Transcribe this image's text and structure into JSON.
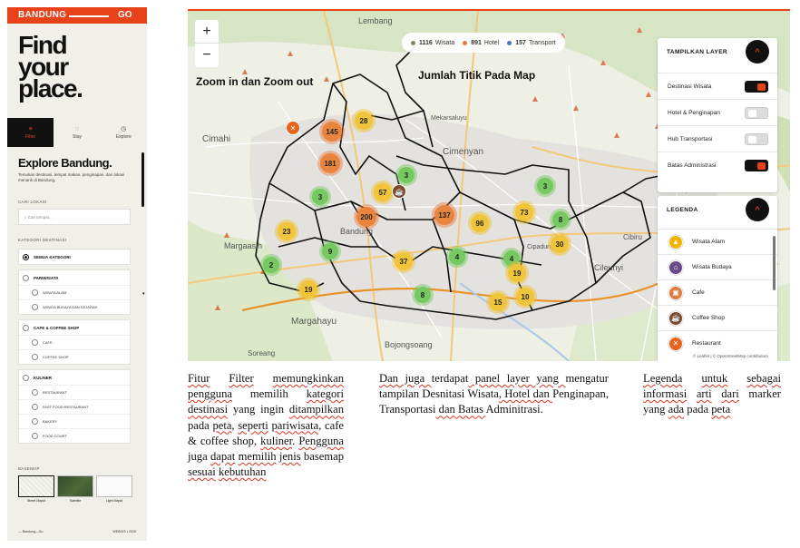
{
  "sidebar": {
    "brand": "BANDUNG",
    "brand_suffix": "GO",
    "hero": "Find\nyour\nplace.",
    "tabs": [
      {
        "label": "Filter",
        "icon": "filter-icon",
        "active": true
      },
      {
        "label": "Stay",
        "icon": "stay-icon",
        "active": false
      },
      {
        "label": "Explore",
        "icon": "explore-icon",
        "active": false
      }
    ],
    "explore_title": "Explore Bandung.",
    "explore_desc": "Temukan destinasi, tempat makan, penginapan, dan lokasi menarik di Bandung.",
    "search_label": "CARI LOKASI",
    "search_placeholder": "Cari tempat...",
    "category_label": "KATEGORI DESTINASI",
    "all_category": "SEMUA KATEGORI",
    "categories": [
      {
        "label": "PARIWISATA",
        "items": [
          "WISATA ALAM",
          "WISATA BUDAYA DAN SEJARAH"
        ]
      },
      {
        "label": "CAFE & COFFEE SHOP",
        "items": [
          "CAFE",
          "COFFEE SHOP"
        ]
      },
      {
        "label": "KULINER",
        "items": [
          "RESTAURANT",
          "FAST FOOD RESTAURANT",
          "BAKERY",
          "FOOD COURT"
        ]
      }
    ],
    "basemap_label": "BASEMAP",
    "basemaps": [
      {
        "label": "Street Mapid",
        "selected": true
      },
      {
        "label": "Satellite",
        "selected": false
      },
      {
        "label": "Light Mapid",
        "selected": false
      }
    ],
    "footer_left": "— Bandung—Go",
    "footer_right": "WEBGIS • 2025"
  },
  "map": {
    "zoom_in": "+",
    "zoom_out": "−",
    "annotation_zoom": "Zoom in dan Zoom out",
    "annotation_count": "Jumlah Titik Pada Map",
    "stats": [
      {
        "value": "1116",
        "label": "Wisata",
        "color": "#7a8a6a"
      },
      {
        "value": "891",
        "label": "Hotel",
        "color": "#e07a3c"
      },
      {
        "value": "157",
        "label": "Transport",
        "color": "#4a78c8"
      }
    ],
    "places": [
      "Lembang",
      "Cimahi",
      "Cimenyan",
      "Margahayu",
      "Bojongsoang",
      "Cileunyi",
      "Margaasih",
      "Mekarsaluyu",
      "Bandung",
      "Cibiru",
      "Cipadung",
      "Soreang"
    ],
    "clusters": [
      {
        "n": "28",
        "c": "yellow"
      },
      {
        "n": "145",
        "c": "orange"
      },
      {
        "n": "181",
        "c": "orange"
      },
      {
        "n": "3",
        "c": "green"
      },
      {
        "n": "57",
        "c": "yellow"
      },
      {
        "n": "3",
        "c": "green"
      },
      {
        "n": "200",
        "c": "orange"
      },
      {
        "n": "137",
        "c": "orange"
      },
      {
        "n": "96",
        "c": "yellow"
      },
      {
        "n": "73",
        "c": "yellow"
      },
      {
        "n": "3",
        "c": "green"
      },
      {
        "n": "8",
        "c": "green"
      },
      {
        "n": "23",
        "c": "yellow"
      },
      {
        "n": "9",
        "c": "green"
      },
      {
        "n": "2",
        "c": "green"
      },
      {
        "n": "37",
        "c": "yellow"
      },
      {
        "n": "4",
        "c": "green"
      },
      {
        "n": "4",
        "c": "green"
      },
      {
        "n": "30",
        "c": "yellow"
      },
      {
        "n": "19",
        "c": "yellow"
      },
      {
        "n": "19",
        "c": "yellow"
      },
      {
        "n": "8",
        "c": "green"
      },
      {
        "n": "15",
        "c": "yellow"
      },
      {
        "n": "10",
        "c": "yellow"
      }
    ],
    "layer_panel": {
      "title": "TAMPILKAN LAYER",
      "toggle": "^",
      "layers": [
        {
          "label": "Destinasi Wisata",
          "on": true
        },
        {
          "label": "Hotel & Penginapan",
          "on": false
        },
        {
          "label": "Hub Transportasi",
          "on": false
        },
        {
          "label": "Batas Administrasi",
          "on": true
        }
      ]
    },
    "legend_panel": {
      "title": "LEGENDA",
      "toggle": "^",
      "items": [
        {
          "label": "Wisata Alam",
          "icon": "mountain-icon",
          "color": "#f0b400"
        },
        {
          "label": "Wisata Budaya",
          "icon": "temple-icon",
          "color": "#6a4a8a"
        },
        {
          "label": "Cafe",
          "icon": "cafe-icon",
          "color": "#e07a3c"
        },
        {
          "label": "Coffee Shop",
          "icon": "coffee-icon",
          "color": "#7a4a2a"
        },
        {
          "label": "Restaurant",
          "icon": "restaurant-icon",
          "color": "#e8641a"
        }
      ]
    },
    "attribution": "© Leaflet | © OpenStreetMap contributors"
  },
  "captions": {
    "filter": [
      "Fitur",
      " ",
      "Filter",
      " ",
      "memungkinkan",
      " ",
      "pengguna",
      " memilih ",
      "kategori",
      " ",
      "destinasi",
      " yang ingin ",
      "ditampilkan",
      " pada ",
      "peta",
      ", ",
      "seperti",
      " ",
      "pariwisata",
      ", cafe & coffee shop, ",
      "kuliner",
      ". ",
      "Pengguna",
      " juga ",
      "dapat",
      " ",
      "memilih",
      " ",
      "jenis",
      " basemap ",
      "sesuai",
      " ",
      "kebutuhan"
    ],
    "layer": [
      "Dan juga ",
      "terdapat",
      " panel layer yang ",
      "mengatur",
      " ",
      "tampilan",
      " ",
      "Desnitasi",
      " ",
      "Wisata",
      ", Hotel dan ",
      "Penginapan",
      ", ",
      "Transportasi",
      " dan Batas ",
      "Adminitrasi",
      "."
    ],
    "legend": [
      "Legenda",
      " ",
      "untuk",
      " ",
      "sebagai",
      " ",
      "informasi",
      " ",
      "arti",
      " ",
      "dari",
      " marker yang ",
      "ada",
      " pada ",
      "peta"
    ]
  }
}
